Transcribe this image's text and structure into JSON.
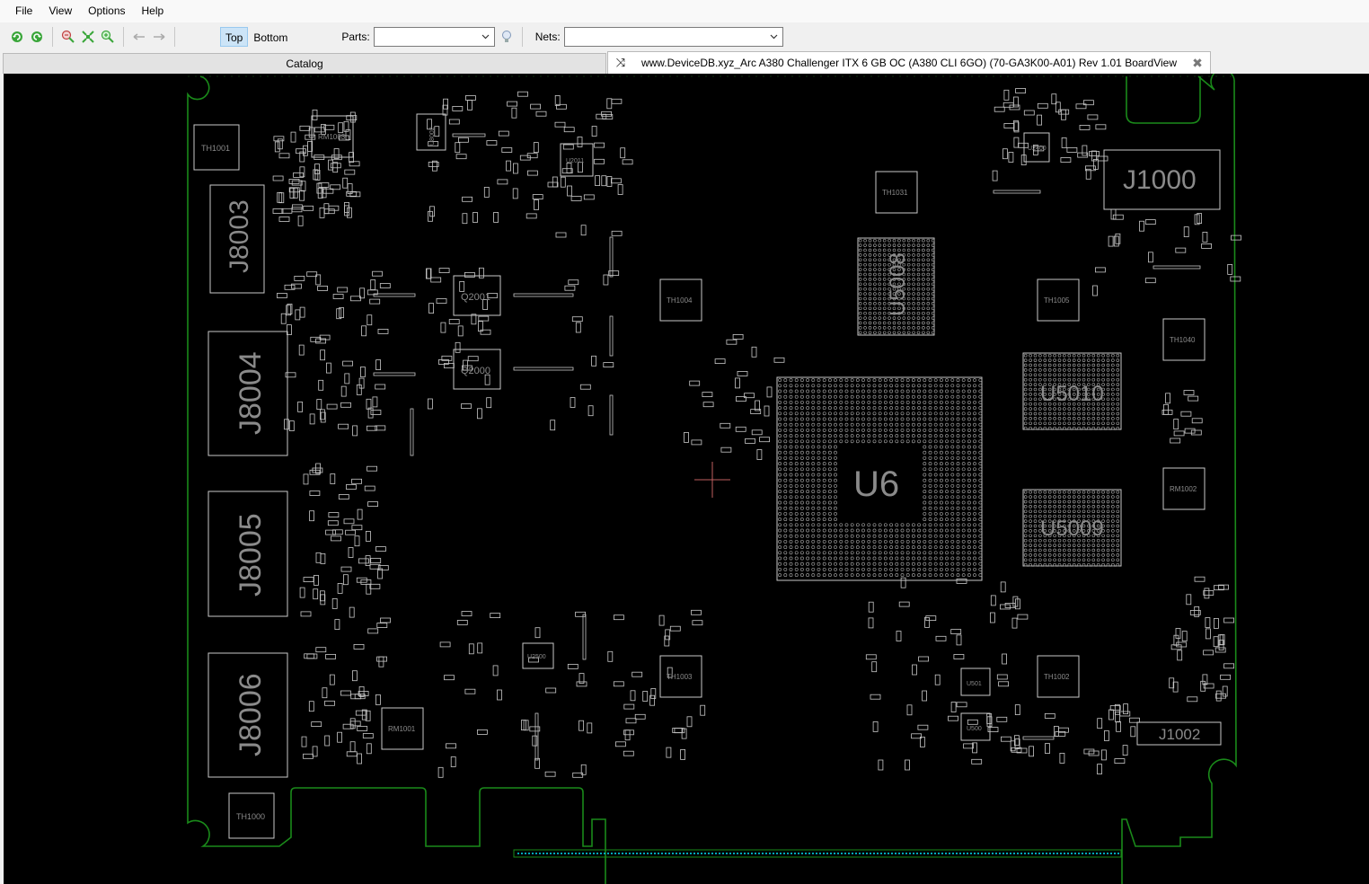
{
  "menu": {
    "file": "File",
    "view": "View",
    "options": "Options",
    "help": "Help"
  },
  "toolbar": {
    "top_label": "Top",
    "bottom_label": "Bottom",
    "parts_label": "Parts:",
    "parts_value": "",
    "nets_label": "Nets:",
    "nets_value": ""
  },
  "tabs": {
    "catalog": "Catalog",
    "board": "www.DeviceDB.xyz_Arc A380 Challenger ITX 6 GB OC (A380 CLI 6GO) (70-GA3K00-A01) Rev 1.01 BoardView",
    "close_glyph": "✖",
    "swap_glyph": "⤨"
  },
  "colors": {
    "outline": "#1a8a1a",
    "component": "#c8c8c8",
    "label": "#8a8a8a",
    "pin": "#00c8c8",
    "cursor": "#c06060"
  },
  "labels": {
    "J8003": "J8003",
    "J8004": "J8004",
    "J8005": "J8005",
    "J8006": "J8006",
    "J1000": "J1000",
    "J1002": "J1002",
    "U6": "U6",
    "U5008": "U5008",
    "U5010": "U5010",
    "U5009": "U5009",
    "TH1001": "TH1001",
    "TH1000": "TH1000",
    "TH1031": "TH1031",
    "TH1004": "TH1004",
    "TH1005": "TH1005",
    "TH1040": "TH1040",
    "TH1003": "TH1003",
    "TH1002": "TH1002",
    "RM1003": "RM1003",
    "RM1001": "RM1001",
    "RM1002": "RM1002",
    "Q2001": "Q2001",
    "Q2000": "Q2000",
    "U8002": "U8002",
    "U2011": "U2011",
    "U2400": "U2400",
    "U2500": "U2500",
    "U501": "U501",
    "U500": "U500"
  }
}
